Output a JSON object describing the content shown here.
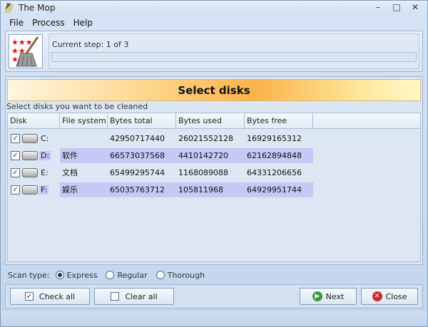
{
  "window": {
    "title": "The Mop"
  },
  "menu": [
    "File",
    "Process",
    "Help"
  ],
  "step": {
    "label": "Current step: 1 of 3",
    "progress": 0
  },
  "banner": {
    "title": "Select disks"
  },
  "instruction": "Select disks you want to be cleaned",
  "table": {
    "columns": [
      "Disk",
      "File system",
      "Bytes total",
      "Bytes used",
      "Bytes free"
    ],
    "rows": [
      {
        "checked": true,
        "drive": "C:",
        "file_system": "",
        "total": "42950717440",
        "used": "26021552128",
        "free": "16929165312",
        "selected": false
      },
      {
        "checked": true,
        "drive": "D:",
        "file_system": "软件",
        "total": "66573037568",
        "used": "4410142720",
        "free": "62162894848",
        "selected": true
      },
      {
        "checked": true,
        "drive": "E:",
        "file_system": "文档",
        "total": "65499295744",
        "used": "1168089088",
        "free": "64331206656",
        "selected": false
      },
      {
        "checked": true,
        "drive": "F:",
        "file_system": "娱乐",
        "total": "65035763712",
        "used": "105811968",
        "free": "64929951744",
        "selected": true
      }
    ]
  },
  "scan": {
    "label": "Scan type:",
    "options": [
      "Express",
      "Regular",
      "Thorough"
    ],
    "selected": "Express"
  },
  "buttons": {
    "check_all": "Check all",
    "clear_all": "Clear all",
    "next": "Next",
    "close": "Close"
  },
  "colors": {
    "selected_row": "#c6c8f5",
    "banner_accent": "#fbb24a"
  }
}
